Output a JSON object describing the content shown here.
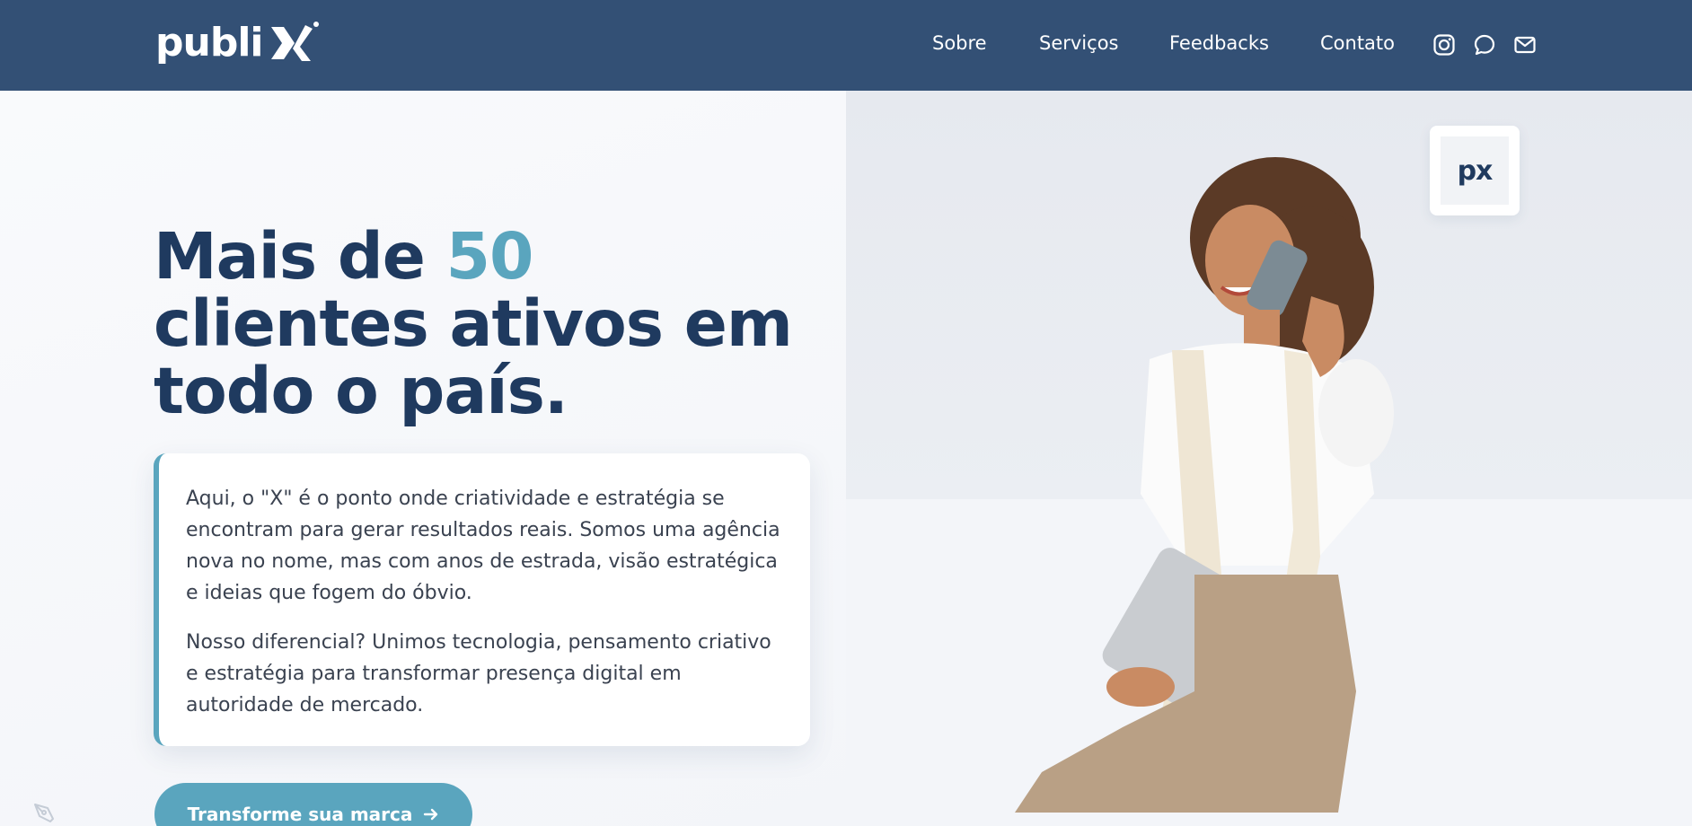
{
  "header": {
    "logo": {
      "text": "publi",
      "mark": "X"
    },
    "nav": [
      {
        "label": "Sobre"
      },
      {
        "label": "Serviços"
      },
      {
        "label": "Feedbacks"
      },
      {
        "label": "Contato"
      }
    ],
    "social": [
      "instagram-icon",
      "chat-icon",
      "mail-icon"
    ]
  },
  "hero": {
    "headline": {
      "part1": "Mais de ",
      "accent": "50",
      "line2": "clientes ativos em",
      "line3": "todo o país."
    },
    "card": {
      "paragraph1": "Aqui, o \"X\" é o ponto onde criatividade e estratégia se encontram para gerar resultados reais. Somos uma agência nova no nome, mas com anos de estrada, visão estratégica e ideias que fogem do óbvio.",
      "paragraph2": "Nosso diferencial? Unimos tecnologia, pensamento criativo e estratégia para transformar presença digital em autoridade de mercado."
    },
    "cta": {
      "label": "Transforme sua marca",
      "icon": "arrow-right-icon"
    },
    "badge": {
      "text": "px"
    }
  },
  "colors": {
    "header_bg": "#335075",
    "navy": "#1f3a5f",
    "accent": "#5aa5be",
    "page_bg": "#f6f8fb"
  }
}
